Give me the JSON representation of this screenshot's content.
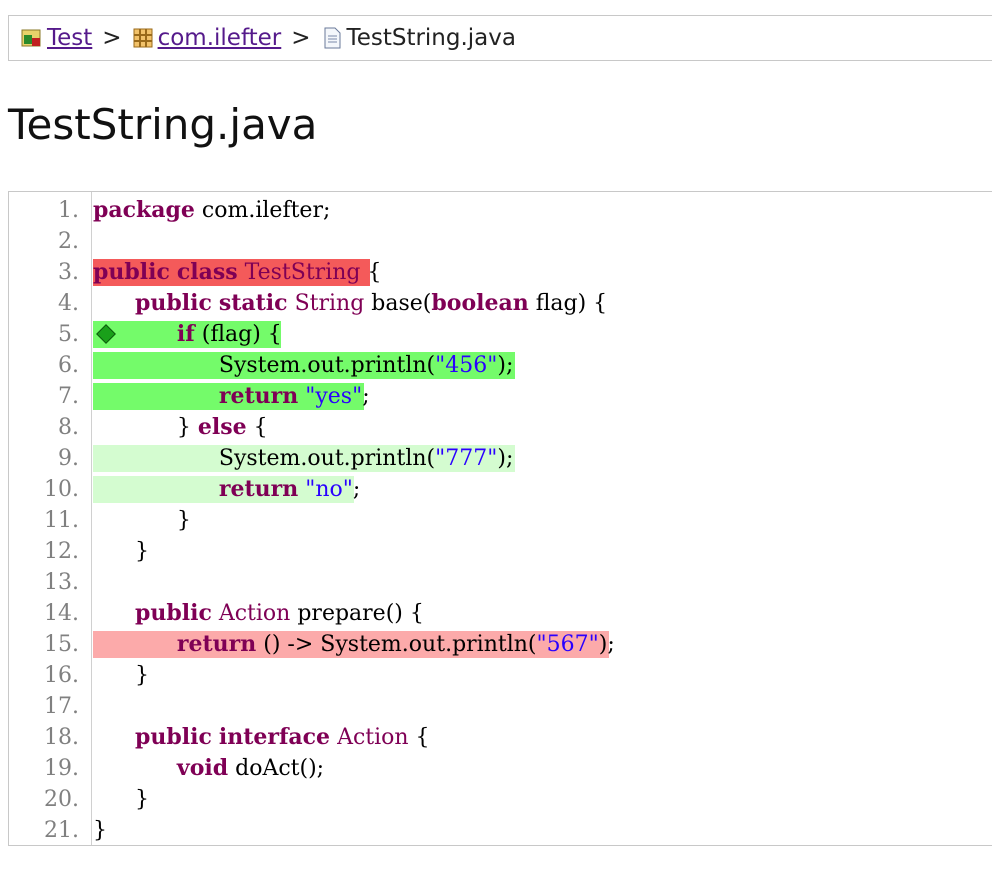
{
  "breadcrumb": {
    "items": [
      {
        "label": "Test",
        "icon": "project-icon",
        "link": true
      },
      {
        "label": "com.ilefter",
        "icon": "package-icon",
        "link": true
      },
      {
        "label": "TestString.java",
        "icon": "java-file-icon",
        "link": false
      }
    ],
    "separator": ">"
  },
  "title": "TestString.java",
  "code": {
    "lines": [
      {
        "n": "1.",
        "text": "package com.ilefter;",
        "coverage": "none"
      },
      {
        "n": "2.",
        "text": "",
        "coverage": "none"
      },
      {
        "n": "3.",
        "text": "public class TestString {",
        "coverage": "full-red"
      },
      {
        "n": "4.",
        "text": "      public static String base(boolean flag) {",
        "coverage": "none"
      },
      {
        "n": "5.",
        "text": "            if (flag) {",
        "coverage": "full-green"
      },
      {
        "n": "6.",
        "text": "                  System.out.println(\"456\");",
        "coverage": "full-green"
      },
      {
        "n": "7.",
        "text": "                  return \"yes\";",
        "coverage": "full-green"
      },
      {
        "n": "8.",
        "text": "            } else {",
        "coverage": "none"
      },
      {
        "n": "9.",
        "text": "                  System.out.println(\"777\");",
        "coverage": "part-green"
      },
      {
        "n": "10.",
        "text": "                  return \"no\";",
        "coverage": "part-green"
      },
      {
        "n": "11.",
        "text": "            }",
        "coverage": "none"
      },
      {
        "n": "12.",
        "text": "      }",
        "coverage": "none"
      },
      {
        "n": "13.",
        "text": "",
        "coverage": "none"
      },
      {
        "n": "14.",
        "text": "      public Action prepare() {",
        "coverage": "none"
      },
      {
        "n": "15.",
        "text": "            return () -> System.out.println(\"567\");",
        "coverage": "part-red"
      },
      {
        "n": "16.",
        "text": "      }",
        "coverage": "none"
      },
      {
        "n": "17.",
        "text": "",
        "coverage": "none"
      },
      {
        "n": "18.",
        "text": "      public interface Action {",
        "coverage": "none"
      },
      {
        "n": "19.",
        "text": "            void doAct();",
        "coverage": "none"
      },
      {
        "n": "20.",
        "text": "      }",
        "coverage": "none"
      },
      {
        "n": "21.",
        "text": "}",
        "coverage": "none"
      }
    ],
    "branch_marker_line": "5.",
    "branch_marker_icon": "diamond-icon",
    "colors": {
      "full_red": "#f45a5a",
      "full_green": "#74fb6a",
      "part_green": "#d4fcd0",
      "part_red": "#fcaaaa",
      "keyword": "#7f0055",
      "string": "#2a00ff"
    }
  }
}
